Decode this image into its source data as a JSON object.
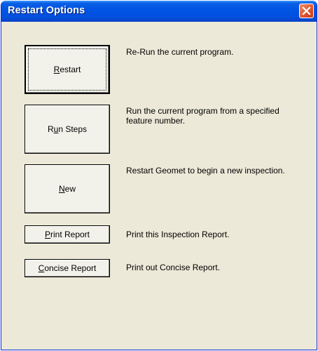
{
  "window": {
    "title": "Restart Options"
  },
  "options": [
    {
      "label_pre": "",
      "label_mn": "R",
      "label_post": "estart",
      "description": "Re-Run the current program."
    },
    {
      "label_pre": "R",
      "label_mn": "u",
      "label_post": "n Steps",
      "description": "Run the current program from a specified feature number."
    },
    {
      "label_pre": "",
      "label_mn": "N",
      "label_post": "ew",
      "description": "Restart Geomet to begin a new inspection."
    },
    {
      "label_pre": "",
      "label_mn": "P",
      "label_post": "rint Report",
      "description": "Print this Inspection Report."
    },
    {
      "label_pre": "",
      "label_mn": "C",
      "label_post": "oncise Report",
      "description": "Print out Concise Report."
    }
  ],
  "icons": {
    "close": "close-icon"
  },
  "colors": {
    "titlebar": "#0054e3",
    "close": "#e0562f",
    "dialog_bg": "#ece9d8"
  }
}
